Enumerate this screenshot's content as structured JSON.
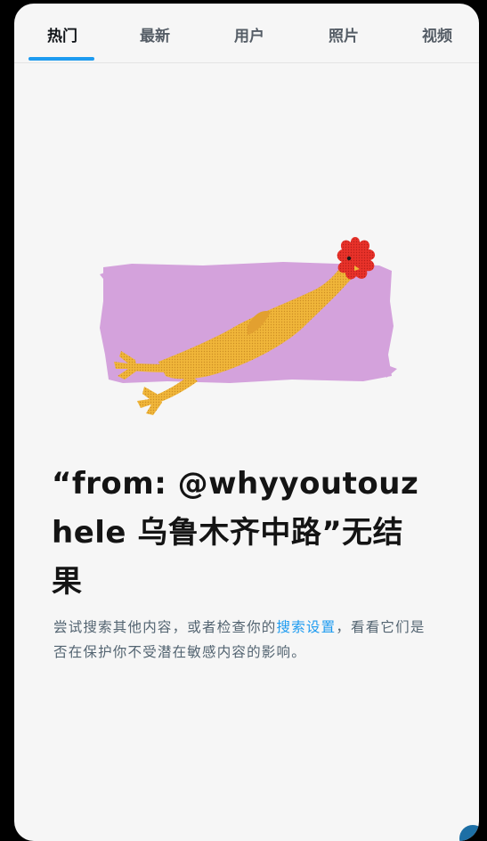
{
  "tabs": [
    {
      "label": "热门",
      "active": true
    },
    {
      "label": "最新",
      "active": false
    },
    {
      "label": "用户",
      "active": false
    },
    {
      "label": "照片",
      "active": false
    },
    {
      "label": "视频",
      "active": false
    }
  ],
  "empty_state": {
    "headline": "“from: @whyyoutouzhele 乌鲁木齐中路”无结果",
    "desc_before": "尝试搜索其他内容，或者检查你的",
    "desc_link": "搜索设置",
    "desc_after": "，看看它们是否在保护你不受潜在敏感内容的影响。"
  },
  "colors": {
    "accent": "#1d9bf0",
    "background": "#f6f6f6",
    "text_primary": "#141414",
    "text_secondary": "#536471",
    "illustration_bg": "#d4a2dc"
  }
}
